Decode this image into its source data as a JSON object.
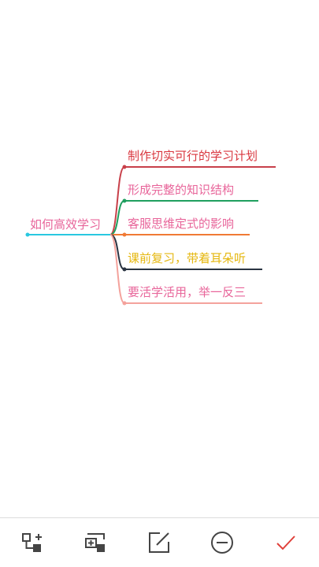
{
  "mindmap": {
    "root": {
      "label": "如何高效学习",
      "color": "#e8659a",
      "line_color": "#29c8e0"
    },
    "branches": [
      {
        "label": "制作切实可行的学习计划",
        "color": "#d9363e"
      },
      {
        "label": "形成完整的知识结构",
        "color": "#e8659a",
        "line_color": "#1f9f5f"
      },
      {
        "label": "客服思维定式的影响",
        "color": "#e8659a",
        "line_color": "#f07a35"
      },
      {
        "label": "课前复习，带着耳朵听",
        "color": "#e5b70f",
        "line_color": "#2a3442"
      },
      {
        "label": "要活学活用，举一反三",
        "color": "#e8659a",
        "line_color": "#f4a29c"
      }
    ]
  },
  "toolbar": {
    "buttons": [
      {
        "icon": "add-child-node-icon"
      },
      {
        "icon": "add-sibling-node-icon"
      },
      {
        "icon": "edit-icon"
      },
      {
        "icon": "remove-icon"
      },
      {
        "icon": "confirm-icon",
        "color": "#e0403a"
      }
    ]
  }
}
